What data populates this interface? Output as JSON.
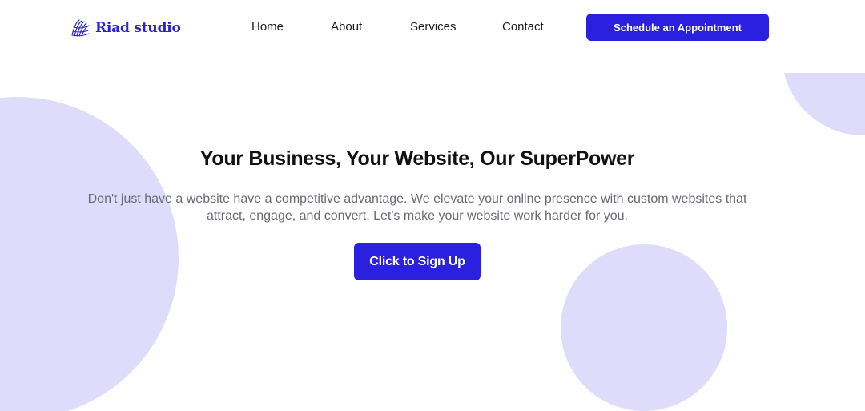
{
  "colors": {
    "accent": "#2b1fe0",
    "brand_text": "#2a22d6",
    "decor_circle": "#dedcfa",
    "heading": "#111111",
    "body_text": "#6a6a72"
  },
  "header": {
    "logo": {
      "icon": "scribble-logo-icon",
      "text": "Riad studio"
    },
    "nav": {
      "items": [
        {
          "label": "Home"
        },
        {
          "label": "About"
        },
        {
          "label": "Services"
        },
        {
          "label": "Contact"
        }
      ]
    },
    "cta_label": "Schedule an Appointment"
  },
  "hero": {
    "title": "Your Business, Your Website, Our SuperPower",
    "description": "Don't just have a website have a competitive advantage. We elevate your online presence with custom websites that attract, engage, and convert. Let's make your website work harder for you.",
    "cta_label": "Click to Sign Up"
  }
}
